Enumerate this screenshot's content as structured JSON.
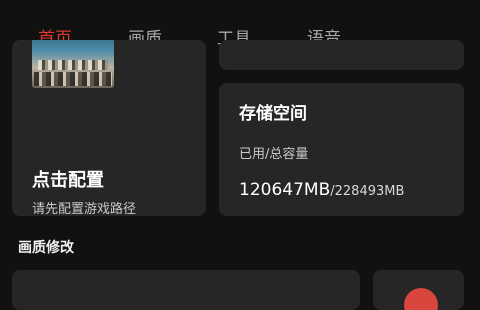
{
  "tabs": [
    {
      "label": "首页",
      "active": true
    },
    {
      "label": "画质",
      "active": false
    },
    {
      "label": "工具",
      "active": false
    },
    {
      "label": "语音",
      "active": false
    }
  ],
  "colors": {
    "accent": "#e0392d",
    "background": "#111111",
    "card": "#262626"
  },
  "game_path_card": {
    "title": "点击配置",
    "subtitle": "请先配置游戏路径"
  },
  "storage_card": {
    "title": "存储空间",
    "subtitle": "已用/总容量",
    "used": "120647MB",
    "separator": "/",
    "total": "228493MB"
  },
  "sections": {
    "quality_modify": "画质修改"
  }
}
